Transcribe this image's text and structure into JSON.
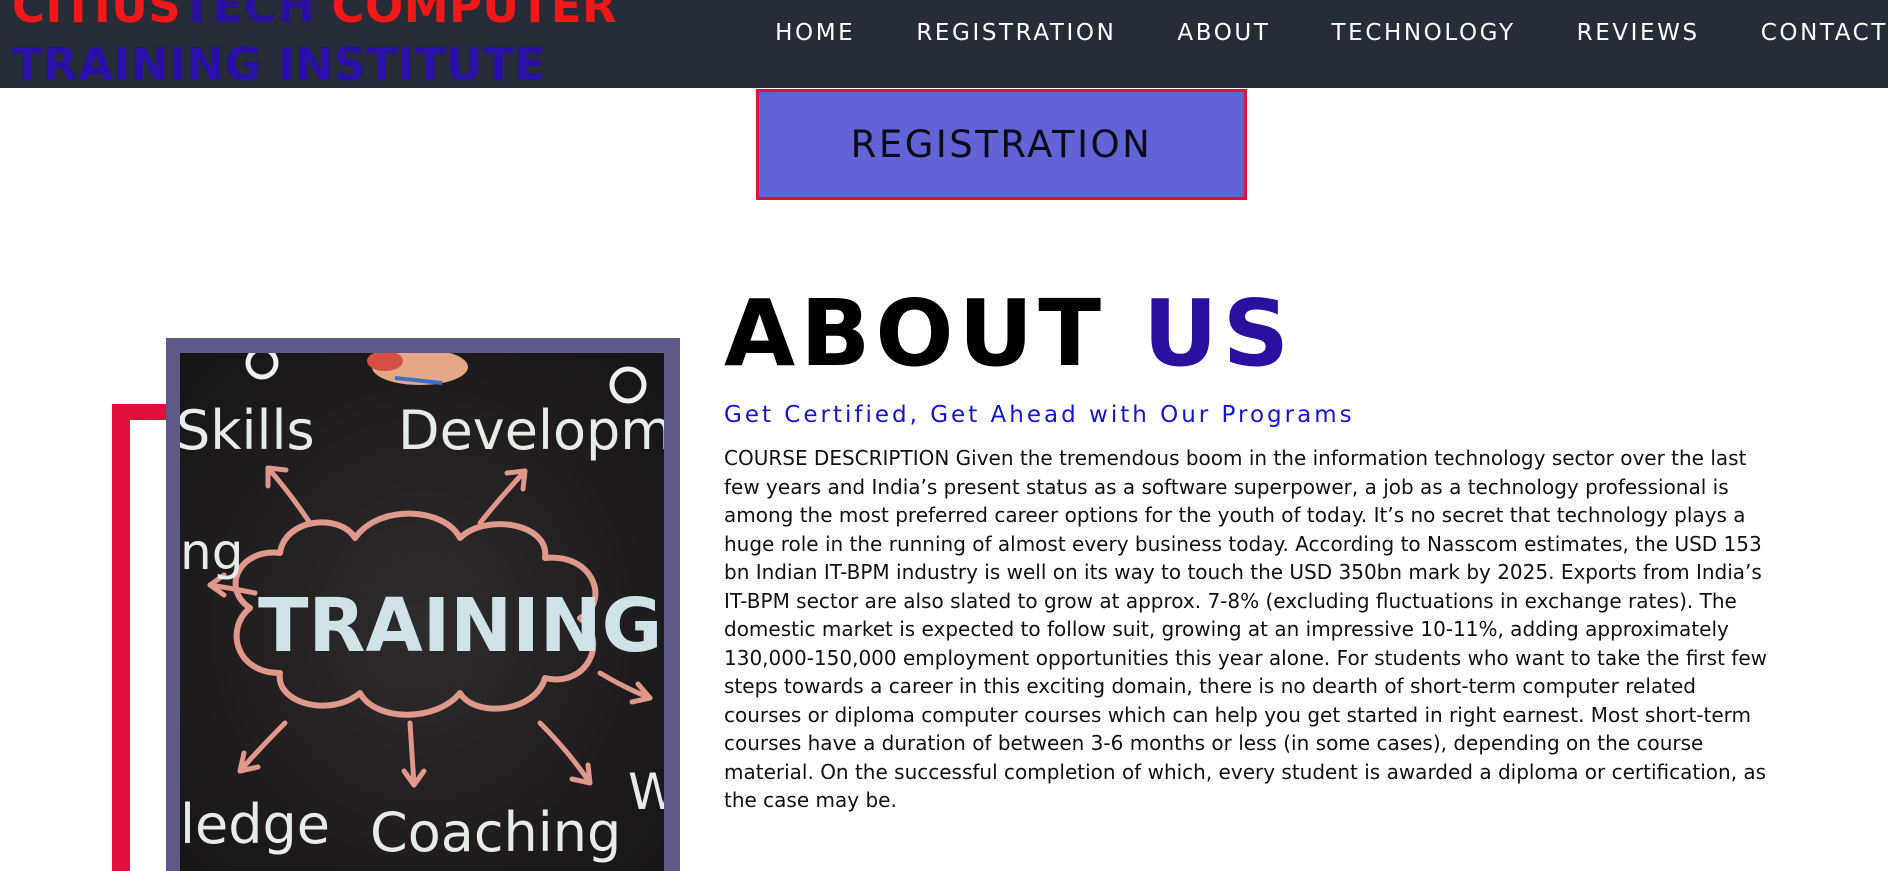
{
  "brand": {
    "line1_part1": "CITIUS",
    "line1_part2": "TECH",
    "line1_part3": " COMPUTER",
    "line2": "TRAINING INSTITUTE"
  },
  "nav": {
    "items": [
      {
        "label": "HOME"
      },
      {
        "label": "REGISTRATION"
      },
      {
        "label": "ABOUT"
      },
      {
        "label": "TECHNOLOGY"
      },
      {
        "label": "REVIEWS"
      },
      {
        "label": "CONTACT"
      }
    ]
  },
  "registration_banner": {
    "label": "REGISTRATION"
  },
  "image": {
    "words": {
      "skills": "Skills",
      "development": "Developmer",
      "ng": "ng",
      "training": "TRAINING",
      "ledge": "ledge",
      "coaching": "Coaching",
      "w": "W"
    }
  },
  "about": {
    "title_part1": "ABOUT ",
    "title_part2": "US",
    "subtitle": "Get Certified, Get Ahead with Our Programs",
    "description": "COURSE DESCRIPTION Given the tremendous boom in the information technology sector over the last few years and India’s present status as a software superpower, a job as a technology professional is among the most preferred career options for the youth of today. It’s no secret that technology plays a huge role in the running of almost every business today. According to Nasscom estimates, the USD 153 bn Indian IT-BPM industry is well on its way to touch the USD 350bn mark by 2025. Exports from India’s IT-BPM sector are also slated to grow at approx. 7-8% (excluding fluctuations in exchange rates). The domestic market is expected to follow suit, growing at an impressive 10-11%, adding approximately 130,000-150,000 employment opportunities this year alone. For students who want to take the first few steps towards a career in this exciting domain, there is no dearth of short-term computer related courses or diploma computer courses which can help you get started in right earnest. Most short-term courses have a duration of between 3-6 months or less (in some cases), depending on the course material. On the successful completion of which, every student is awarded a diploma or certification, as the case may be."
  },
  "colors": {
    "header_bg": "#262d36",
    "brand_red": "#f01818",
    "brand_blue": "#2a10a8",
    "banner_bg": "#6363d8",
    "banner_border": "#e0103a",
    "accent_red": "#e0103a",
    "subtitle_blue": "#1515d0"
  }
}
